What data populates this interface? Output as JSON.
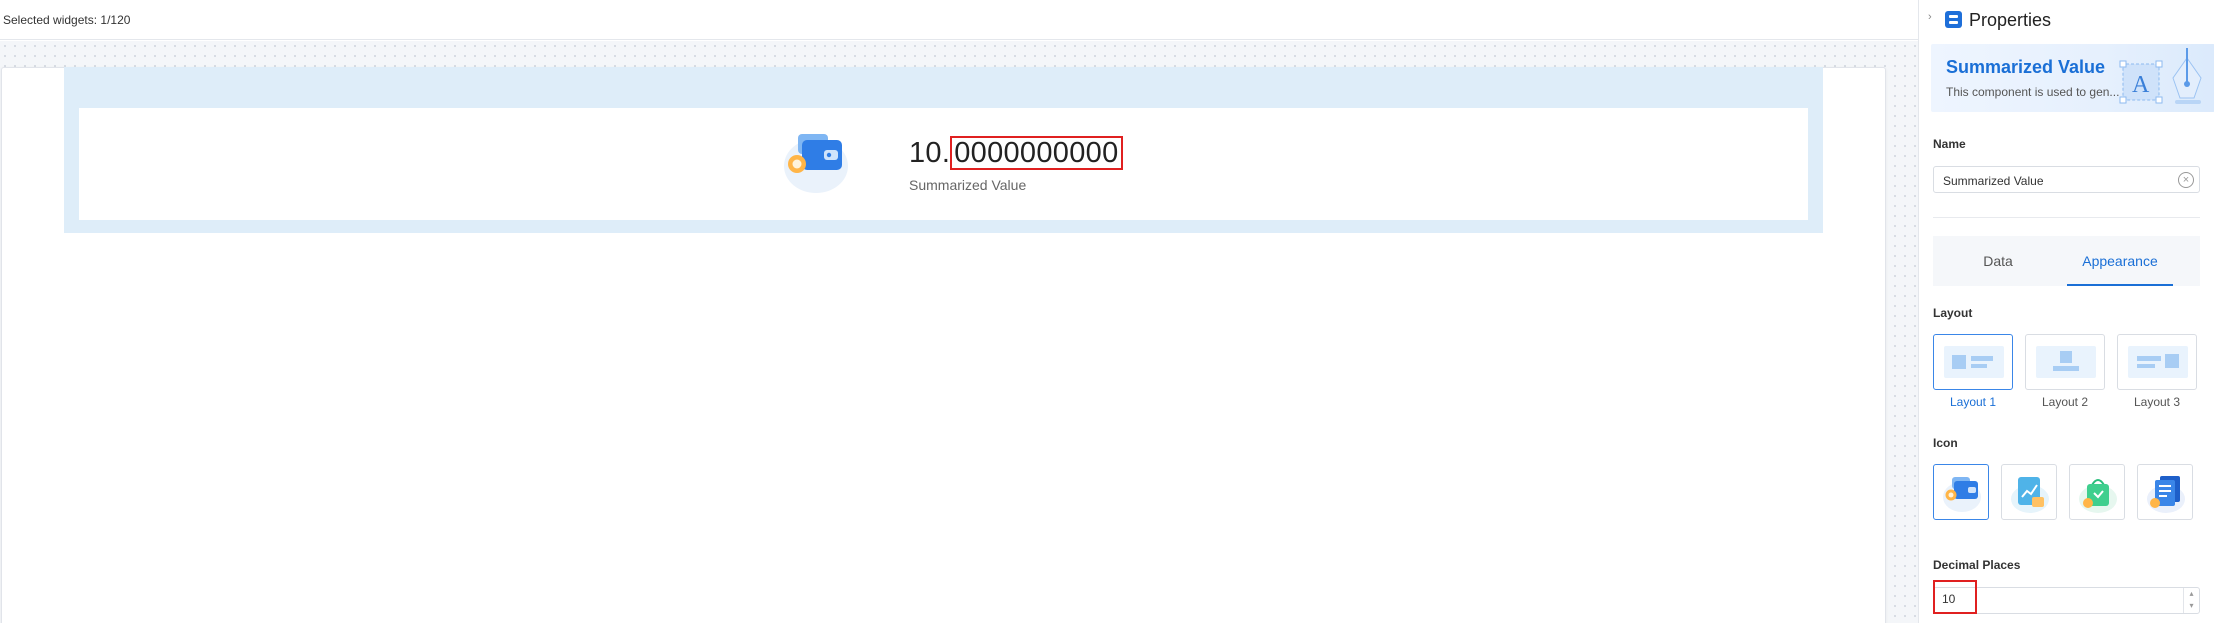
{
  "toolbar": {
    "selected_widgets": "Selected widgets: 1/120"
  },
  "widget": {
    "value_int": "10.",
    "value_dec": "0000000000",
    "label": "Summarized Value",
    "icon": "wallet-coin-icon"
  },
  "panel": {
    "title": "Properties",
    "banner": {
      "title": "Summarized Value",
      "description": "This component is used to gen..."
    },
    "name": {
      "label": "Name",
      "value": "Summarized Value"
    },
    "tabs": [
      {
        "label": "Data"
      },
      {
        "label": "Appearance"
      }
    ],
    "active_tab": "Appearance",
    "layout": {
      "label": "Layout",
      "options": [
        {
          "label": "Layout 1"
        },
        {
          "label": "Layout 2"
        },
        {
          "label": "Layout 3"
        }
      ],
      "selected": "Layout 1"
    },
    "icon": {
      "label": "Icon",
      "options": [
        "wallet-coin-icon",
        "chart-document-icon",
        "shopping-bag-icon",
        "report-document-icon"
      ],
      "selected": "wallet-coin-icon"
    },
    "decimal_places": {
      "label": "Decimal Places",
      "value": "10"
    }
  },
  "colors": {
    "accent": "#1a6fd6",
    "highlight": "#e02020",
    "widget_bg": "#deedf9"
  }
}
